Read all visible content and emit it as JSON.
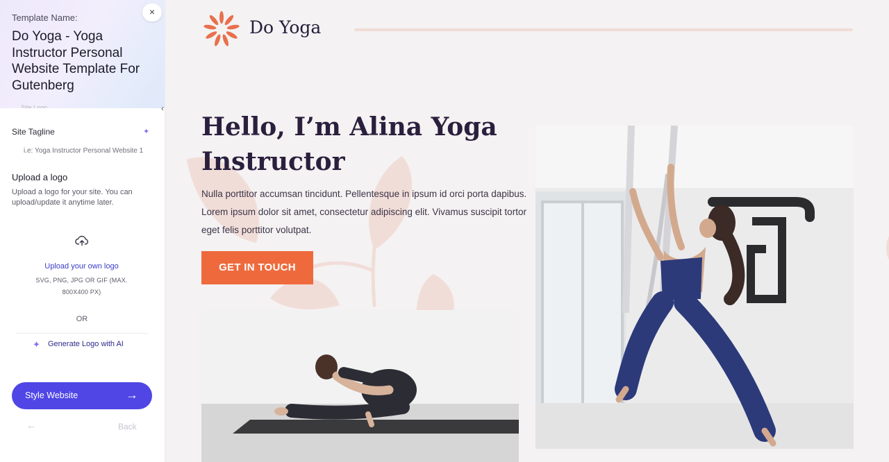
{
  "sidebar": {
    "template_label": "Template Name:",
    "template_name": "Do Yoga - Yoga Instructor Personal Website Template For Gutenberg",
    "close_icon": "×",
    "collapse_icon": "‹",
    "site_tagline_label": "Site Tagline",
    "site_tagline_placeholder": "i.e:  Yoga Instructor Personal Website 1",
    "upload_title": "Upload a logo",
    "upload_desc": "Upload a logo for your site. You can upload/update it anytime later.",
    "upload_own": "Upload your own logo",
    "upload_formats": "SVG, PNG, JPG OR GIF (MAX. 800X400 PX)",
    "or_text": "OR",
    "generate_logo": "Generate Logo with AI",
    "style_button": "Style Website",
    "back_arrow": "←",
    "back_label": "Back",
    "accent_color": "#4f46e5"
  },
  "preview": {
    "brand_name": "Do Yoga",
    "hero_title": "Hello, I’m Alina Yoga Instructor",
    "hero_text": "Nulla porttitor accumsan tincidunt. Pellentesque in ipsum id orci porta dapibus. Lorem ipsum dolor sit amet, consectetur adipiscing elit. Vivamus suscipit tortor eget felis porttitor volutpat.",
    "cta_label": "GET IN TOUCH",
    "cta_color": "#ee6a3d"
  }
}
